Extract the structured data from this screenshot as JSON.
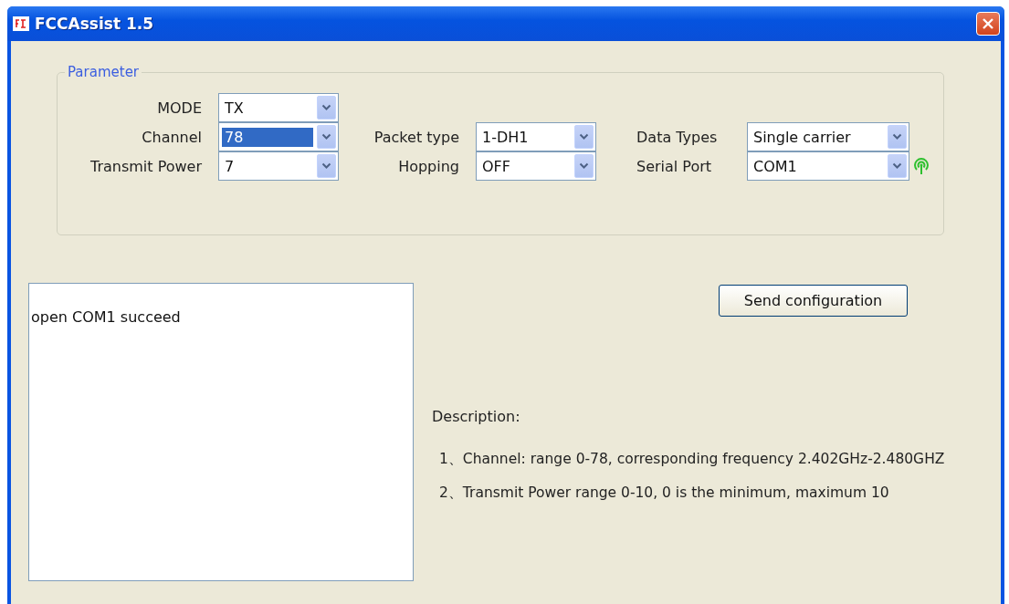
{
  "window": {
    "title": "FCCAssist 1.5"
  },
  "parameter": {
    "title": "Parameter",
    "rows": [
      [
        {
          "label": "MODE",
          "value": "TX",
          "focused": false,
          "kind": "combo"
        }
      ],
      [
        {
          "label": "Channel",
          "value": "78",
          "focused": true,
          "kind": "combo"
        },
        {
          "label": "Packet type",
          "value": "1-DH1",
          "focused": false,
          "kind": "combo"
        },
        {
          "label": "Data Types",
          "value": "Single carrier",
          "focused": false,
          "kind": "combo"
        }
      ],
      [
        {
          "label": "Transmit Power",
          "value": "7",
          "focused": false,
          "kind": "combo"
        },
        {
          "label": "Hopping",
          "value": "OFF",
          "focused": false,
          "kind": "combo"
        },
        {
          "label": "Serial Port",
          "value": "COM1",
          "focused": false,
          "kind": "port"
        }
      ]
    ]
  },
  "log": {
    "text": "open COM1 succeed"
  },
  "send_button": "Send configuration",
  "description": {
    "title": "Description:",
    "lines": [
      "1、Channel: range 0-78, corresponding frequency 2.402GHz-2.480GHZ",
      "2、Transmit Power  range 0-10, 0 is the minimum, maximum 10"
    ]
  }
}
